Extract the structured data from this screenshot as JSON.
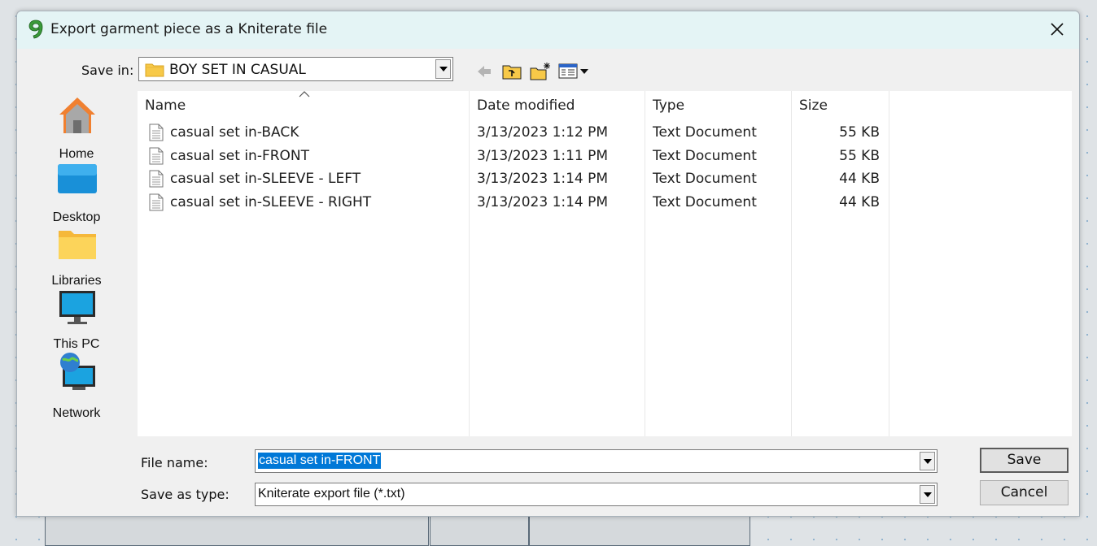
{
  "window": {
    "title": "Export garment piece as a Kniterate file"
  },
  "toolbar": {
    "save_in_label": "Save in:",
    "save_in_value": "BOY SET IN CASUAL",
    "back_icon": "back-arrow-icon",
    "up_icon": "up-folder-icon",
    "new_folder_icon": "new-folder-icon",
    "view_icon": "view-menu-icon"
  },
  "places": [
    {
      "label": "Home",
      "icon": "home-icon"
    },
    {
      "label": "Desktop",
      "icon": "desktop-icon"
    },
    {
      "label": "Libraries",
      "icon": "libraries-icon"
    },
    {
      "label": "This PC",
      "icon": "this-pc-icon"
    },
    {
      "label": "Network",
      "icon": "network-icon"
    }
  ],
  "columns": [
    "Name",
    "Date modified",
    "Type",
    "Size"
  ],
  "files": [
    {
      "name": "casual set in-BACK",
      "date": "3/13/2023 1:12 PM",
      "type": "Text Document",
      "size": "55 KB"
    },
    {
      "name": "casual set in-FRONT",
      "date": "3/13/2023 1:11 PM",
      "type": "Text Document",
      "size": "55 KB"
    },
    {
      "name": "casual set in-SLEEVE - LEFT",
      "date": "3/13/2023 1:14 PM",
      "type": "Text Document",
      "size": "44 KB"
    },
    {
      "name": "casual set in-SLEEVE - RIGHT",
      "date": "3/13/2023 1:14 PM",
      "type": "Text Document",
      "size": "44 KB"
    }
  ],
  "form": {
    "file_name_label": "File name:",
    "file_name_value": "casual set in-FRONT",
    "save_type_label": "Save as type:",
    "save_type_value": "Kniterate export file (*.txt)"
  },
  "buttons": {
    "save": "Save",
    "cancel": "Cancel"
  },
  "colors": {
    "accent_selection": "#0078d7",
    "titlebar": "#e4f4f5"
  }
}
